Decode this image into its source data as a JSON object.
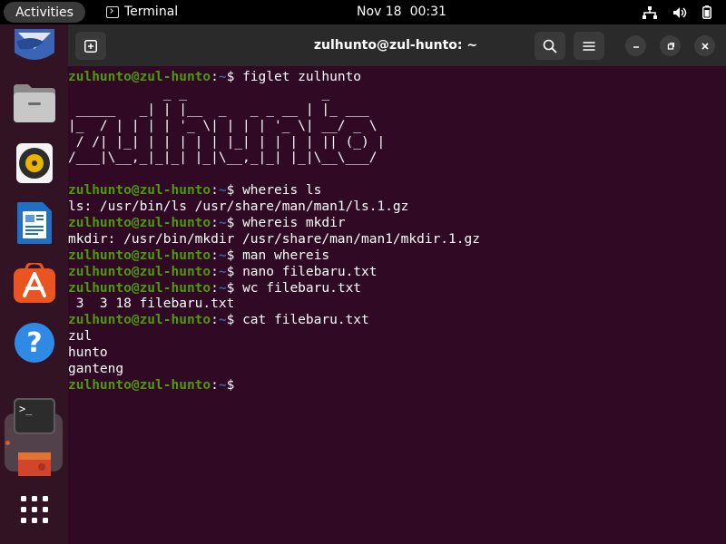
{
  "topbar": {
    "activities": "Activities",
    "app_name": "Terminal",
    "date": "Nov 18",
    "time": "00:31",
    "tray_icons": [
      "network-icon",
      "volume-icon",
      "battery-icon"
    ]
  },
  "dock": {
    "items": [
      "thunderbird-icon",
      "files-icon",
      "rhythmbox-icon",
      "libreoffice-writer-icon",
      "software-center-icon",
      "help-icon",
      "terminal-icon",
      "app-partial-icon",
      "show-apps-grid-icon"
    ],
    "accent": "#e95420"
  },
  "window": {
    "title": "zulhunto@zul-hunto: ~",
    "prompt_user": "zulhunto@zul-hunto",
    "prompt_path": "~",
    "colors": {
      "background": "#300a24",
      "user": "#4e9a06",
      "path": "#3465a4",
      "text": "#ffffff"
    }
  },
  "terminal": {
    "lines": [
      {
        "p": true,
        "cmd": "figlet zulhunto"
      },
      {
        "t": "            _ _                 _"
      },
      {
        "t": " _____   _| | |__  _   _ _ __ | |_ ___"
      },
      {
        "t": "|_  / | | | | '_ \\| | | | '_ \\| __/ _ \\"
      },
      {
        "t": " / /| |_| | | | | | |_| | | | | || (_) |"
      },
      {
        "t": "/___|\\__,_|_|_| |_|\\__,_|_| |_|\\__\\___/"
      },
      {
        "t": ""
      },
      {
        "p": true,
        "cmd": "whereis ls"
      },
      {
        "t": "ls: /usr/bin/ls /usr/share/man/man1/ls.1.gz"
      },
      {
        "p": true,
        "cmd": "whereis mkdir"
      },
      {
        "t": "mkdir: /usr/bin/mkdir /usr/share/man/man1/mkdir.1.gz"
      },
      {
        "p": true,
        "cmd": "man whereis"
      },
      {
        "p": true,
        "cmd": "nano filebaru.txt"
      },
      {
        "p": true,
        "cmd": "wc filebaru.txt"
      },
      {
        "t": " 3  3 18 filebaru.txt"
      },
      {
        "p": true,
        "cmd": "cat filebaru.txt"
      },
      {
        "t": "zul"
      },
      {
        "t": "hunto"
      },
      {
        "t": "ganteng"
      },
      {
        "p": true,
        "cmd": ""
      }
    ]
  }
}
